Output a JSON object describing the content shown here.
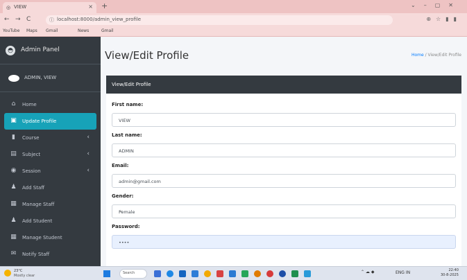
{
  "browser": {
    "tab_title": "VIEW",
    "url": "localhost:8000/admin_view_profile",
    "bookmarks": [
      "YouTube",
      "Maps",
      "Gmail",
      "News",
      "Gmail"
    ]
  },
  "sidebar": {
    "brand": "Admin Panel",
    "user_name": "ADMIN, VIEW",
    "items": [
      {
        "label": "Home",
        "icon": "home-icon",
        "glyph": "⌂",
        "chev": ""
      },
      {
        "label": "Update Profile",
        "icon": "id-card-icon",
        "glyph": "▣",
        "chev": ""
      },
      {
        "label": "Course",
        "icon": "bookmark-icon",
        "glyph": "▮",
        "chev": "‹"
      },
      {
        "label": "Subject",
        "icon": "book-icon",
        "glyph": "▤",
        "chev": "‹"
      },
      {
        "label": "Session",
        "icon": "clock-icon",
        "glyph": "◉",
        "chev": "‹"
      },
      {
        "label": "Add Staff",
        "icon": "user-plus-icon",
        "glyph": "♟",
        "chev": ""
      },
      {
        "label": "Manage Staff",
        "icon": "table-icon",
        "glyph": "▦",
        "chev": ""
      },
      {
        "label": "Add Student",
        "icon": "user-plus-icon",
        "glyph": "♟",
        "chev": ""
      },
      {
        "label": "Manage Student",
        "icon": "table-icon",
        "glyph": "▦",
        "chev": ""
      },
      {
        "label": "Notify Staff",
        "icon": "megaphone-icon",
        "glyph": "✉",
        "chev": ""
      }
    ]
  },
  "main": {
    "title": "View/Edit Profile",
    "breadcrumb_home": "Home",
    "breadcrumb_current": "View/Edit Profile",
    "card_title": "View/Edit Profile",
    "fields": {
      "first_name_label": "First name:",
      "first_name": "VIEW",
      "last_name_label": "Last name:",
      "last_name": "ADMIN",
      "email_label": "Email:",
      "email": "admin@gmail.com",
      "gender_label": "Gender:",
      "gender": "Female",
      "password_label": "Password:",
      "password": "••••"
    }
  },
  "taskbar": {
    "temp": "23°C",
    "weather": "Mostly clear",
    "search": "Search",
    "lang": "ENG",
    "region": "IN",
    "time": "22:40",
    "date": "30-8-2025"
  },
  "colors": {
    "sidebar_bg": "#343a40",
    "active_item": "#17a2b8",
    "card_header": "#343a40",
    "link": "#007bff",
    "browser_chrome": "#f6dada"
  }
}
